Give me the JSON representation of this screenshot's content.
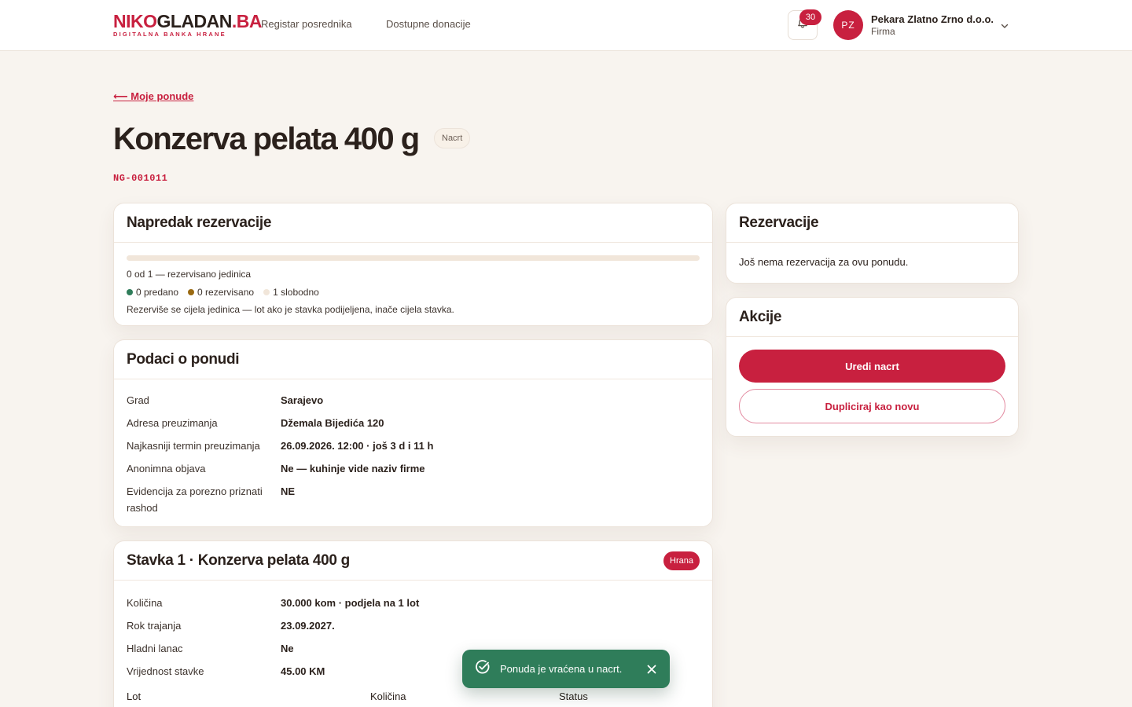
{
  "brand": {
    "logo_part1": "NIKO",
    "logo_part2": "GLADAN",
    "logo_part3": ".BA",
    "tagline": "DIGITALNA BANKA HRANE",
    "accent_color": "#c8203f"
  },
  "nav": {
    "items": [
      {
        "label": "Registar posrednika"
      },
      {
        "label": "Dostupne donacije"
      }
    ]
  },
  "notifications": {
    "icon": "bell-icon",
    "count": "30"
  },
  "user": {
    "initials": "PZ",
    "name": "Pekara Zlatno Zrno d.o.o.",
    "role": "Firma"
  },
  "page": {
    "back_link": "⟵ Moje ponude",
    "title": "Konzerva pelata 400 g",
    "status": "Nacrt",
    "code": "NG-001011"
  },
  "progress_card": {
    "title": "Napredak rezervacije",
    "reserved_fraction": 0,
    "summary": "0 od 1 — rezervisano jedinica",
    "legend": [
      {
        "label": "0 predano",
        "color": "#2f7d5a"
      },
      {
        "label": "0 rezervisano",
        "color": "#9a6a12"
      },
      {
        "label": "1 slobodno",
        "color": "#f1e6da"
      }
    ],
    "note": "Rezerviše se cijela jedinica — lot ako je stavka podijeljena, inače cijela stavka."
  },
  "offer_details": {
    "title": "Podaci o ponudi",
    "rows": [
      {
        "key": "Grad",
        "value": "Sarajevo"
      },
      {
        "key": "Adresa preuzimanja",
        "value": "Džemala Bijedića 120"
      },
      {
        "key": "Najkasniji termin preuzimanja",
        "value": "26.09.2026. 12:00 · još 3 d i 11 h"
      },
      {
        "key": "Anonimna objava",
        "value": "Ne — kuhinje vide naziv firme"
      },
      {
        "key": "Evidencija za porezno priznati rashod",
        "value": "NE"
      }
    ]
  },
  "item_card": {
    "title": "Stavka 1 · Konzerva pelata 400 g",
    "category": "Hrana",
    "rows": [
      {
        "key": "Količina",
        "value": "30.000 kom · podjela na 1 lot"
      },
      {
        "key": "Rok trajanja",
        "value": "23.09.2027."
      },
      {
        "key": "Hladni lanac",
        "value": "Ne"
      },
      {
        "key": "Vrijednost stavke",
        "value": "45.00 KM"
      }
    ],
    "lot_columns": [
      "Lot",
      "Količina",
      "Status"
    ]
  },
  "reservations_card": {
    "title": "Rezervacije",
    "empty_text": "Još nema rezervacija za ovu ponudu."
  },
  "actions_card": {
    "title": "Akcije",
    "primary_label": "Uredi nacrt",
    "secondary_label": "Dupliciraj kao novu"
  },
  "toast": {
    "text": "Ponuda je vraćena u nacrt.",
    "color": "#2f7d5a"
  }
}
